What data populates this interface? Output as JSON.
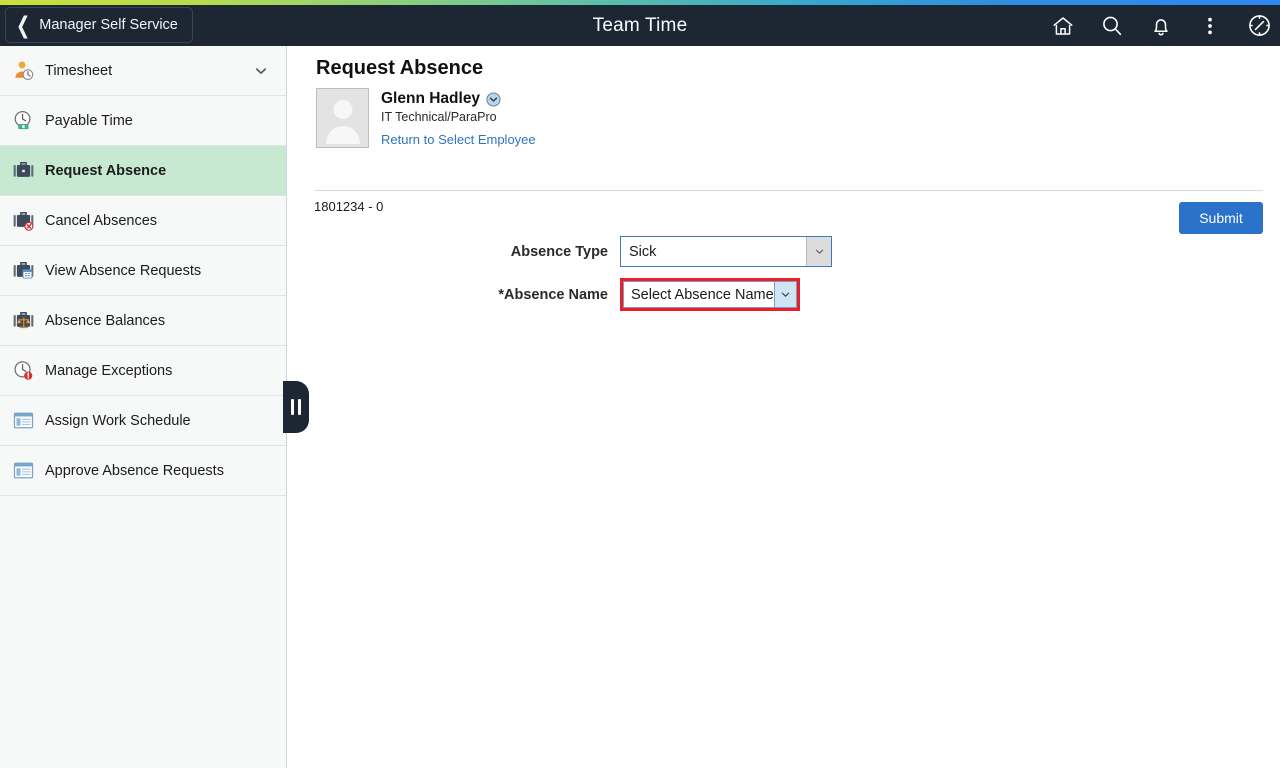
{
  "header": {
    "back_label": "Manager Self Service",
    "back_icon": "chevron-left-icon",
    "title": "Team Time",
    "icons": [
      {
        "name": "home-icon"
      },
      {
        "name": "search-icon"
      },
      {
        "name": "notifications-bell-icon"
      },
      {
        "name": "actions-kebab-icon"
      },
      {
        "name": "navigator-compass-icon"
      }
    ]
  },
  "sidebar": {
    "collapse_handle_icon": "pause-bars-icon",
    "items": [
      {
        "label": "Timesheet",
        "icon": "person-clock-icon",
        "active": false,
        "expandable": true,
        "chevron_icon": "chevron-down-icon"
      },
      {
        "label": "Payable Time",
        "icon": "clock-money-icon",
        "active": false,
        "expandable": false
      },
      {
        "label": "Request Absence",
        "icon": "briefcase-icon",
        "active": true,
        "expandable": false
      },
      {
        "label": "Cancel Absences",
        "icon": "briefcase-cancel-icon",
        "active": false,
        "expandable": false
      },
      {
        "label": "View Absence Requests",
        "icon": "briefcase-grid-icon",
        "active": false,
        "expandable": false
      },
      {
        "label": "Absence Balances",
        "icon": "briefcase-scale-icon",
        "active": false,
        "expandable": false
      },
      {
        "label": "Manage Exceptions",
        "icon": "clock-alert-icon",
        "active": false,
        "expandable": false
      },
      {
        "label": "Assign Work Schedule",
        "icon": "window-list-icon",
        "active": false,
        "expandable": false
      },
      {
        "label": "Approve Absence Requests",
        "icon": "window-list-icon",
        "active": false,
        "expandable": false
      }
    ]
  },
  "main": {
    "page_title": "Request Absence",
    "employee": {
      "avatar_icon": "employee-photo-placeholder-icon",
      "name": "Glenn Hadley",
      "related_actions_icon": "related-actions-chevron-icon",
      "job_title": "IT Technical/ParaPro",
      "return_link": "Return to Select Employee",
      "id_line": "1801234 - 0"
    },
    "submit_label": "Submit",
    "form": {
      "absence_type": {
        "label": "Absence Type",
        "value": "Sick",
        "chevron_icon": "chevron-down-icon"
      },
      "absence_name": {
        "label": "*Absence Name",
        "value": "Select Absence Name",
        "chevron_icon": "chevron-down-icon",
        "highlight_color": "#e8202a"
      }
    }
  },
  "colors": {
    "header_bg": "#1d2733",
    "active_nav_bg": "#c7e8d1",
    "submit_blue": "#2b72cb",
    "link_blue": "#2f73c2",
    "highlight_red": "#e8202a"
  }
}
